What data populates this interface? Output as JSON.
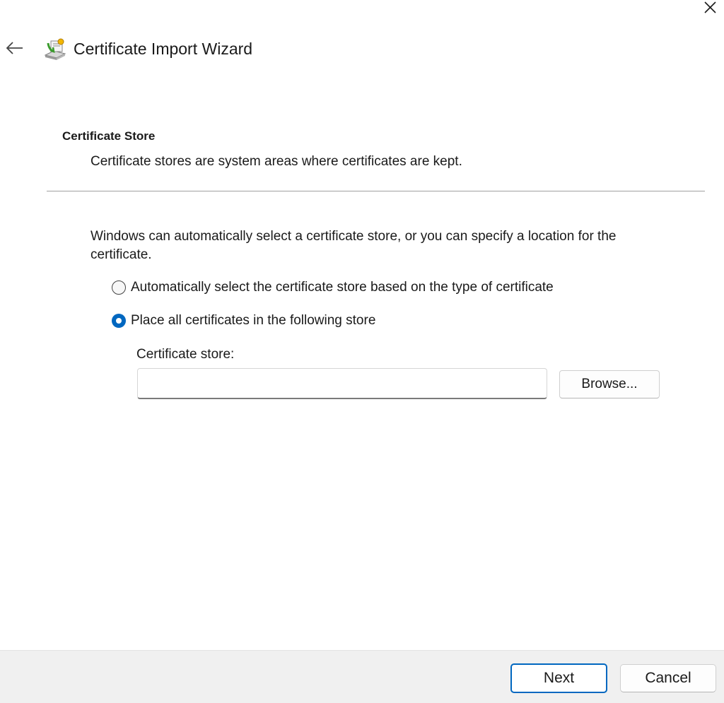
{
  "window": {
    "title": "Certificate Import Wizard",
    "icons": {
      "back": "arrow-left-icon",
      "close": "close-icon",
      "wizard": "certificate-icon"
    }
  },
  "section": {
    "heading": "Certificate Store",
    "description": "Certificate stores are system areas where certificates are kept."
  },
  "content": {
    "intro": "Windows can automatically select a certificate store, or you can specify a location for the certificate.",
    "options": [
      {
        "label": "Automatically select the certificate store based on the type of certificate",
        "selected": false
      },
      {
        "label": "Place all certificates in the following store",
        "selected": true
      }
    ],
    "store": {
      "label": "Certificate store:",
      "value": "",
      "browse_label": "Browse..."
    }
  },
  "footer": {
    "next_label": "Next",
    "cancel_label": "Cancel"
  },
  "colors": {
    "accent": "#0067c0",
    "footer_bg": "#f0f0f0",
    "divider": "#a0a0a0"
  }
}
